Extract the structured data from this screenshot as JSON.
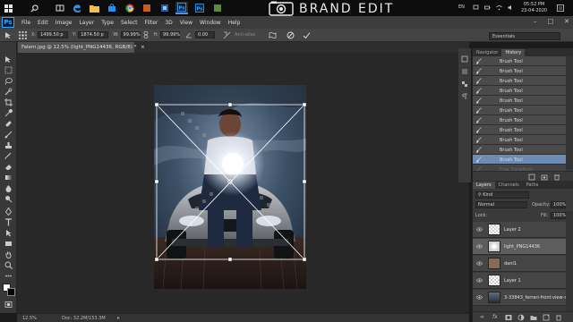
{
  "taskbar": {
    "brand_text": "BRAND EDIT",
    "language": "EN",
    "time": "05:52 PM",
    "date": "23-04-2020"
  },
  "app": {
    "logo": "Ps",
    "menu": [
      "File",
      "Edit",
      "Image",
      "Layer",
      "Type",
      "Select",
      "Filter",
      "3D",
      "View",
      "Window",
      "Help"
    ]
  },
  "options_bar": {
    "x_label": "X:",
    "x_value": "1499.50 p",
    "y_label": "Y:",
    "y_value": "1874.50 p",
    "w_label": "W:",
    "w_value": "99.99%",
    "h_label": "H:",
    "h_value": "99.99%",
    "angle_value": "0.00",
    "antialias_label": "Anti-alias",
    "workspace": "Essentials"
  },
  "document": {
    "tab_title": "Falem.jpg @ 12.5% (light_PNG14436, RGB/8) *",
    "zoom": "12.5%",
    "doc_size": "Doc: 32.2M/153.3M"
  },
  "history_panel": {
    "tabs": [
      "Navigator",
      "History"
    ],
    "active_tab": "History",
    "items": [
      "Brush Tool",
      "Brush Tool",
      "Brush Tool",
      "Brush Tool",
      "Brush Tool",
      "Brush Tool",
      "Brush Tool",
      "Brush Tool",
      "Brush Tool",
      "Brush Tool",
      "Brush Tool",
      "Free Transform"
    ],
    "selected_index": 10
  },
  "layers_panel": {
    "tabs": [
      "Layers",
      "Channels",
      "Paths"
    ],
    "active_tab": "Layers",
    "kind_label": "Kind",
    "blend_mode": "Normal",
    "opacity_label": "Opacity:",
    "opacity_value": "100%",
    "lock_label": "Lock:",
    "fill_label": "Fill:",
    "fill_value": "100%",
    "layers": [
      {
        "name": "Layer 2",
        "selected": false
      },
      {
        "name": "light_PNG14436",
        "selected": true
      },
      {
        "name": "dani1",
        "selected": false
      },
      {
        "name": "Layer 1",
        "selected": false
      },
      {
        "name": "3-33843_ferrari-front-view-c...",
        "selected": false
      }
    ]
  },
  "colors": {
    "selection_blue": "#6e8cb3",
    "ps_blue": "#31a8ff"
  }
}
